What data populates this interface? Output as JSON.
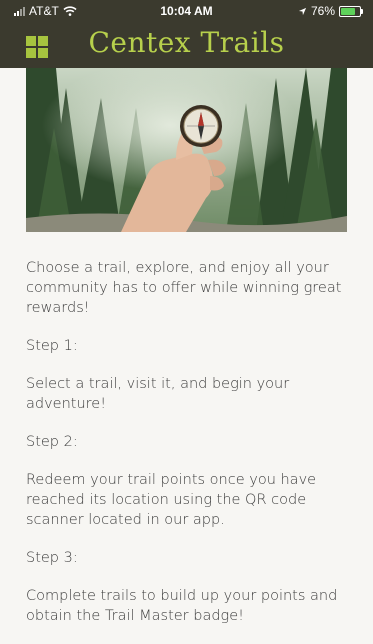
{
  "status_bar": {
    "carrier": "AT&T",
    "time": "10:04 AM",
    "battery": "76%",
    "battery_level": 0.76
  },
  "header": {
    "title": "Centex Trails",
    "menu_icon": "grid-menu-icon"
  },
  "hero": {
    "image_icon": "hand-holding-compass-in-forest"
  },
  "colors": {
    "header_bg": "#3b3a2e",
    "accent": "#b7d04c",
    "background": "#f7f6f3",
    "text": "#3e3e3e"
  },
  "intro": "Choose  a trail, explore, and enjoy all your community has to offer while winning great rewards!",
  "steps": [
    {
      "label": "Step 1:",
      "text": "Select a trail, visit it, and begin your adventure!"
    },
    {
      "label": "Step 2:",
      "text": "Redeem your trail points once you have reached its location using the QR code scanner located in our app."
    },
    {
      "label": "Step 3:",
      "text": "Complete trails to build up your points and obtain the Trail Master badge!"
    }
  ]
}
